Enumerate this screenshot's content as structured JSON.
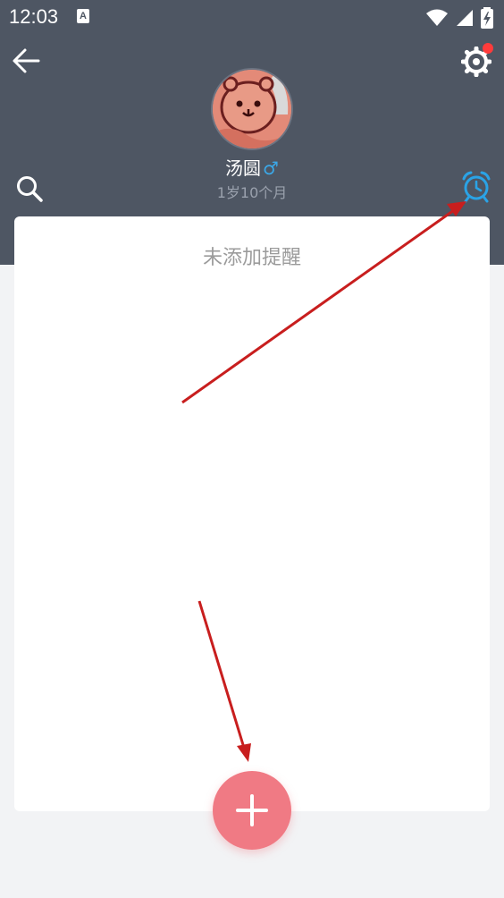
{
  "status_bar": {
    "time": "12:03",
    "notification_letter": "A",
    "icons": [
      "wifi-icon",
      "signal-icon",
      "battery-charging-icon"
    ]
  },
  "header": {
    "back_icon": "arrow-left-icon",
    "settings_icon": "gear-icon",
    "settings_badge_color": "#ff3b3b",
    "search_icon": "search-icon",
    "alarm_icon": "alarm-clock-icon",
    "alarm_color": "#2aa3e6",
    "background_color": "#4e5663"
  },
  "profile": {
    "name": "汤圆",
    "gender_symbol": "♂",
    "age": "1岁10个月"
  },
  "reminders": {
    "empty_text": "未添加提醒"
  },
  "fab": {
    "icon": "plus-icon",
    "color": "#f07a84"
  }
}
